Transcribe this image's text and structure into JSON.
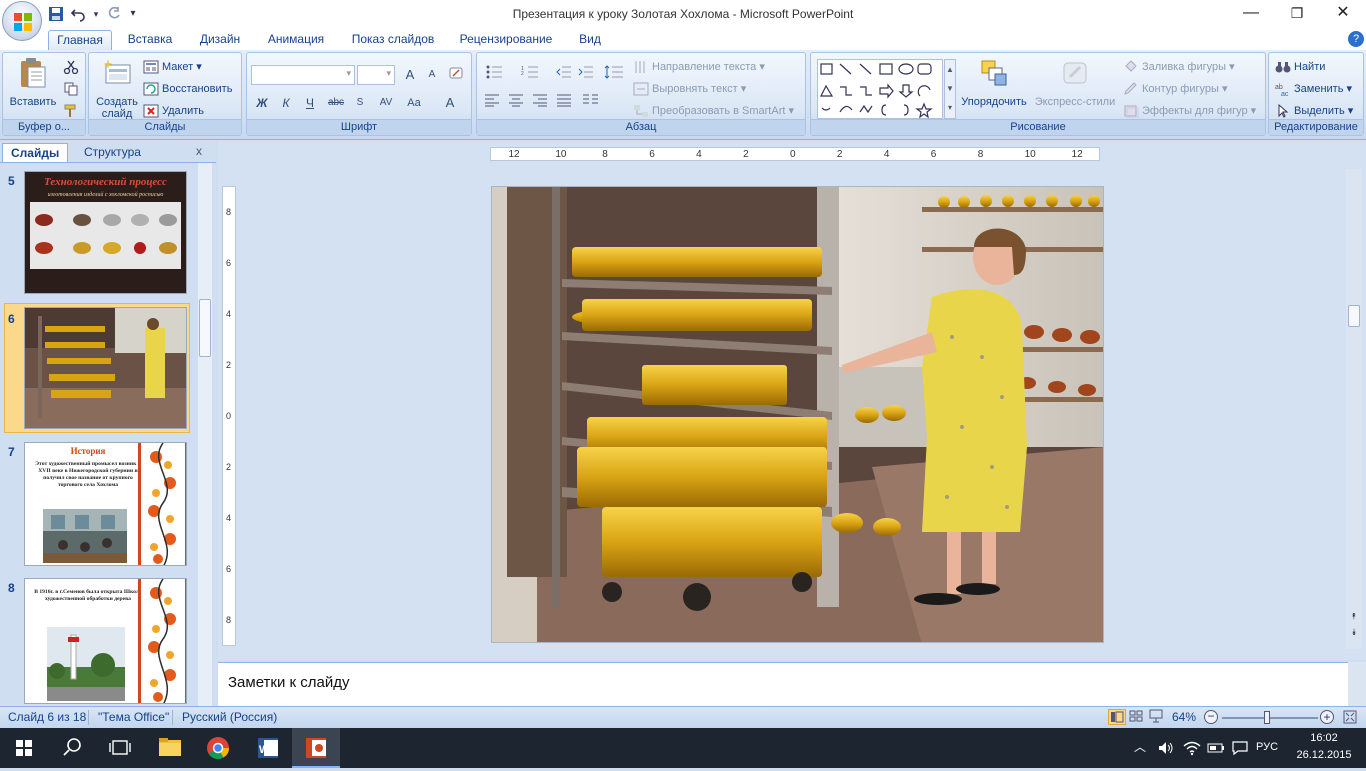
{
  "window": {
    "title": "Презентация к уроку Золотая Хохлома - Microsoft PowerPoint",
    "controls": {
      "minimize": "—",
      "restore": "❐",
      "close": "✕"
    }
  },
  "qat": {
    "save": "save-icon",
    "undo": "undo-icon",
    "redo": "redo-icon",
    "customize": "▾"
  },
  "tabs": [
    {
      "label": "Главная",
      "active": true
    },
    {
      "label": "Вставка"
    },
    {
      "label": "Дизайн"
    },
    {
      "label": "Анимация"
    },
    {
      "label": "Показ слайдов"
    },
    {
      "label": "Рецензирование"
    },
    {
      "label": "Вид"
    }
  ],
  "ribbon": {
    "clipboard": {
      "label": "Буфер о...",
      "paste": "Вставить"
    },
    "slides": {
      "label": "Слайды",
      "new_slide": "Создать слайд",
      "layout": "Макет",
      "reset": "Восстановить",
      "delete": "Удалить"
    },
    "font": {
      "label": "Шрифт",
      "bold": "Ж",
      "italic": "К",
      "underline": "Ч",
      "strike": "abc",
      "spacing": "AV",
      "case": "Aa",
      "color": "A",
      "grow": "A",
      "shrink": "A"
    },
    "paragraph": {
      "label": "Абзац",
      "text_direction": "Направление текста",
      "align_text": "Выровнять текст",
      "smartart": "Преобразовать в SmartArt"
    },
    "drawing": {
      "label": "Рисование",
      "arrange": "Упорядочить",
      "quick_styles": "Экспресс-стили",
      "fill": "Заливка фигуры",
      "outline": "Контур фигуры",
      "effects": "Эффекты для фигур"
    },
    "editing": {
      "label": "Редактирование",
      "find": "Найти",
      "replace": "Заменить",
      "select": "Выделить"
    }
  },
  "pane": {
    "tabs": [
      {
        "label": "Слайды",
        "active": true
      },
      {
        "label": "Структура"
      }
    ],
    "close": "x",
    "thumbs": [
      {
        "num": "5",
        "title": "Технологический процесс",
        "subtitle": "изготовления изделий с хохломской росписью"
      },
      {
        "num": "6",
        "selected": true
      },
      {
        "num": "7",
        "title": "История",
        "text": "Этот художественный промысел возник в XVII веке в Нижегородской губернии и получил свое название от крупного торгового села Хохлома"
      },
      {
        "num": "8",
        "text": "В 1916г. в г.Семенов была открыта Школа художественной обработки дерева"
      }
    ]
  },
  "ruler": {
    "h_ticks": [
      "12",
      "10",
      "8",
      "6",
      "4",
      "2",
      "0",
      "2",
      "4",
      "6",
      "8",
      "10",
      "12"
    ],
    "v_ticks": [
      "8",
      "6",
      "4",
      "2",
      "0",
      "2",
      "4",
      "6",
      "8"
    ]
  },
  "notes": {
    "placeholder": "Заметки к слайду"
  },
  "status": {
    "slide": "Слайд 6 из 18",
    "theme": "\"Тема Office\"",
    "language": "Русский (Россия)",
    "zoom": "64%",
    "zoom_fraction": 0.47
  },
  "taskbar": {
    "lang": "РУС",
    "time": "16:02",
    "date": "26.12.2015"
  },
  "colors": {
    "accent": "#15428b",
    "ribbon": "#d6e3f3",
    "selection": "#fcd98a",
    "gold": "#d9a414"
  }
}
